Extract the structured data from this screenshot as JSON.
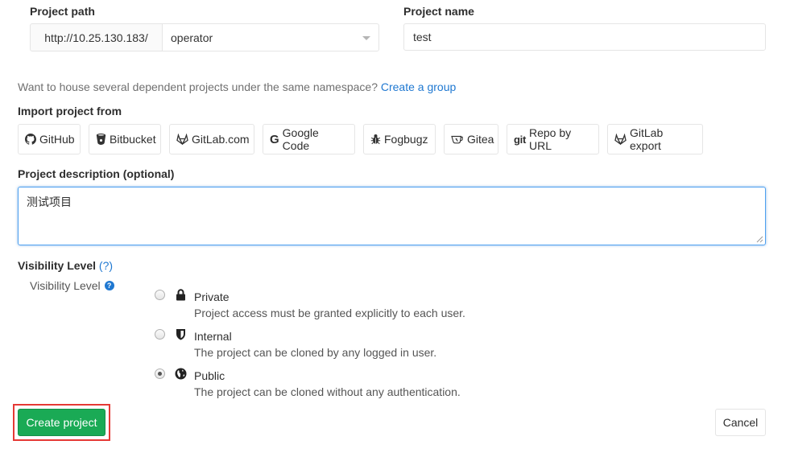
{
  "project_path": {
    "label": "Project path",
    "prefix": "http://10.25.130.183/",
    "namespace": "operator"
  },
  "project_name": {
    "label": "Project name",
    "value": "test"
  },
  "namespace_hint": {
    "text": "Want to house several dependent projects under the same namespace?",
    "link": "Create a group"
  },
  "import": {
    "label": "Import project from",
    "sources": [
      {
        "label": "GitHub",
        "icon": "github-icon"
      },
      {
        "label": "Bitbucket",
        "icon": "bitbucket-icon"
      },
      {
        "label": "GitLab.com",
        "icon": "gitlab-icon"
      },
      {
        "label": "Google Code",
        "icon": "google-icon"
      },
      {
        "label": "Fogbugz",
        "icon": "bug-icon"
      },
      {
        "label": "Gitea",
        "icon": "gitea-icon"
      },
      {
        "label": "Repo by URL",
        "icon": "git-icon",
        "icon_text": "git"
      },
      {
        "label": "GitLab export",
        "icon": "gitlab-icon"
      }
    ]
  },
  "description": {
    "label": "Project description (optional)",
    "value": "测试项目"
  },
  "visibility": {
    "label": "Visibility Level",
    "help": "(?)",
    "sub_label": "Visibility Level",
    "selected": "Public",
    "options": [
      {
        "title": "Private",
        "description": "Project access must be granted explicitly to each user.",
        "icon": "lock-icon"
      },
      {
        "title": "Internal",
        "description": "The project can be cloned by any logged in user.",
        "icon": "shield-icon"
      },
      {
        "title": "Public",
        "description": "The project can be cloned without any authentication.",
        "icon": "globe-icon"
      }
    ]
  },
  "actions": {
    "create": "Create project",
    "cancel": "Cancel"
  },
  "colors": {
    "primary_green": "#1aaa55",
    "link_blue": "#1f78d1",
    "highlight_red": "#e53935"
  }
}
